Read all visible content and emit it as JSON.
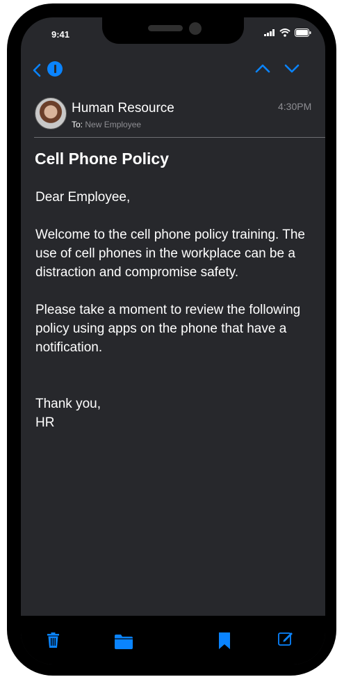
{
  "status_bar": {
    "time": "9:41"
  },
  "nav": {
    "icons": [
      "chevron-left-icon",
      "info-icon",
      "chevron-up-icon",
      "chevron-down-icon"
    ]
  },
  "message": {
    "sender": "Human Resource",
    "to_label": "To:",
    "recipient": "New Employee",
    "time": "4:30PM",
    "subject": "Cell Phone Policy",
    "greeting": "Dear Employee,",
    "paragraph1": "Welcome to the cell phone policy training. The use of cell phones in the workplace can be a distraction and compromise safety.",
    "paragraph2": "Please take a moment to review the following policy using apps on the phone that have a notification.",
    "signoff": "Thank you,",
    "signature": "HR"
  },
  "bottom_bar": {
    "icons": [
      "trash-icon",
      "folder-icon",
      "bookmark-icon",
      "compose-icon"
    ]
  },
  "colors": {
    "accent": "#0a84ff",
    "background": "#27282c",
    "muted": "#8e8e93"
  }
}
